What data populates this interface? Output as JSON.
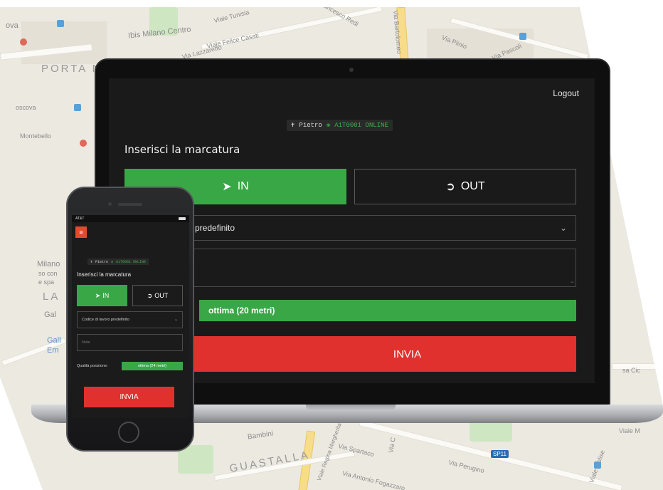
{
  "map": {
    "labels": {
      "porta": "PORTA NU",
      "centro": "Ibis Milano Centro",
      "felice": "Viale Felice Casati",
      "tunisia": "Viale Tunisia",
      "lazzaretto": "Via Lazzaretto",
      "redi": "Via Francesco Redi",
      "bartolomeo": "Via Bartolomeo",
      "plinio": "Via Plinio",
      "pascoli": "Via Pascoli",
      "moscova": "oscova",
      "montebello": "Montebello",
      "milano": "Milano",
      "milano2": "so con",
      "milano3": "e spa",
      "la": "LA",
      "gal": "Gal",
      "gall": "Gall",
      "em": "Em",
      "guastalla": "GUASTALLA",
      "bambini": "Bambini",
      "spartaco": "Via Spartaco",
      "perugino": "Via Perugino",
      "fogazzaro": "Via Antonio Fogazzaro",
      "reginamargherita": "Viale Regina Margherita",
      "molise": "Viale Molise",
      "via_c": "Via C",
      "viale_m": "Viale M",
      "sa_cic": "sa Cic",
      "ova": "ova"
    },
    "metro_badge": "SP11"
  },
  "laptop": {
    "logout": "Logout",
    "user": "Pietro",
    "device_status": "A1T0001 ONLINE",
    "title": "Inserisci la marcatura",
    "btn_in": "IN",
    "btn_out": "OUT",
    "select_value": "o predefinito",
    "quality": "ottima (20 metri)",
    "send": "INVIA"
  },
  "phone": {
    "carrier": "AT&T",
    "user": "Pietro",
    "device_status": "A1T0001 ONLINE",
    "title": "Inserisci la marcatura",
    "btn_in": "IN",
    "btn_out": "OUT",
    "select_value": "Codice di lavoro predefinito",
    "note_placeholder": "Note",
    "quality_label": "Qualità posizione:",
    "quality": "ottima (24 metri)",
    "send": "INVIA"
  },
  "icons": {
    "user": "user-icon",
    "online": "leaf-icon",
    "in": "sign-in-icon",
    "out": "sign-out-icon",
    "chevron": "chevron-down-icon",
    "menu": "hamburger-menu-icon"
  },
  "colors": {
    "green": "#3aa746",
    "red": "#e0312f",
    "menu_orange": "#e34b2e",
    "screen_bg": "#1a1a1a"
  }
}
